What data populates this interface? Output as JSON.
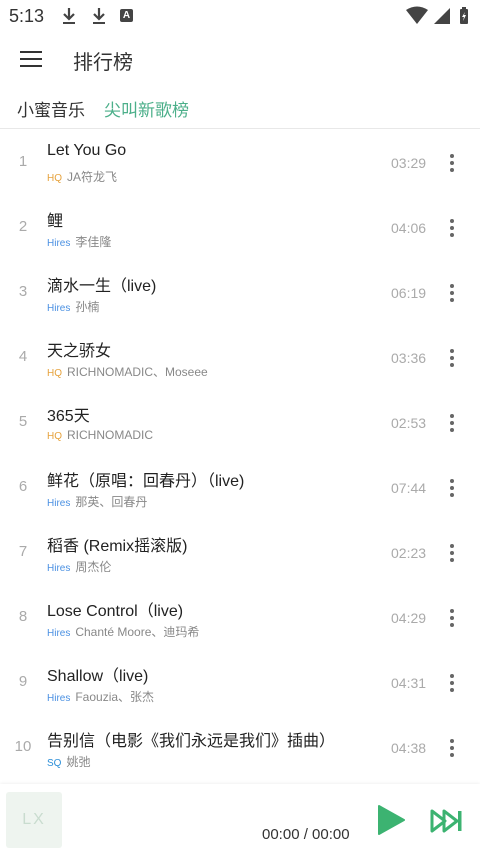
{
  "status_bar": {
    "time": "5:13",
    "notif_letter": "A"
  },
  "header": {
    "title": "排行榜"
  },
  "tabs": [
    {
      "label": "小蜜音乐",
      "active": false
    },
    {
      "label": "尖叫新歌榜",
      "active": true
    }
  ],
  "songs": [
    {
      "index": "1",
      "title": "Let You Go",
      "quality": "HQ",
      "artist": "JA符龙飞",
      "duration": "03:29"
    },
    {
      "index": "2",
      "title": "鲤",
      "quality": "Hires",
      "artist": "李佳隆",
      "duration": "04:06"
    },
    {
      "index": "3",
      "title": "滴水一生（live)",
      "quality": "Hires",
      "artist": "孙楠",
      "duration": "06:19"
    },
    {
      "index": "4",
      "title": "天之骄女",
      "quality": "HQ",
      "artist": "RICHNOMADIC、Moseee",
      "duration": "03:36"
    },
    {
      "index": "5",
      "title": "365天",
      "quality": "HQ",
      "artist": "RICHNOMADIC",
      "duration": "02:53"
    },
    {
      "index": "6",
      "title": "鲜花（原唱：回春丹）（live)",
      "quality": "Hires",
      "artist": "那英、回春丹",
      "duration": "07:44"
    },
    {
      "index": "7",
      "title": "稻香 (Remix摇滚版)",
      "quality": "Hires",
      "artist": "周杰伦",
      "duration": "02:23"
    },
    {
      "index": "8",
      "title": "Lose Control（live)",
      "quality": "Hires",
      "artist": "Chanté Moore、迪玛希",
      "duration": "04:29"
    },
    {
      "index": "9",
      "title": "Shallow（live)",
      "quality": "Hires",
      "artist": "Faouzia、张杰",
      "duration": "04:31"
    },
    {
      "index": "10",
      "title": "告别信（电影《我们永远是我们》插曲）",
      "quality": "SQ",
      "artist": "姚弛",
      "duration": "04:38"
    }
  ],
  "player": {
    "cover_text": "LX",
    "time": "00:00 / 00:00"
  },
  "colors": {
    "accent": "#4caf8a",
    "play": "#3cb371"
  }
}
